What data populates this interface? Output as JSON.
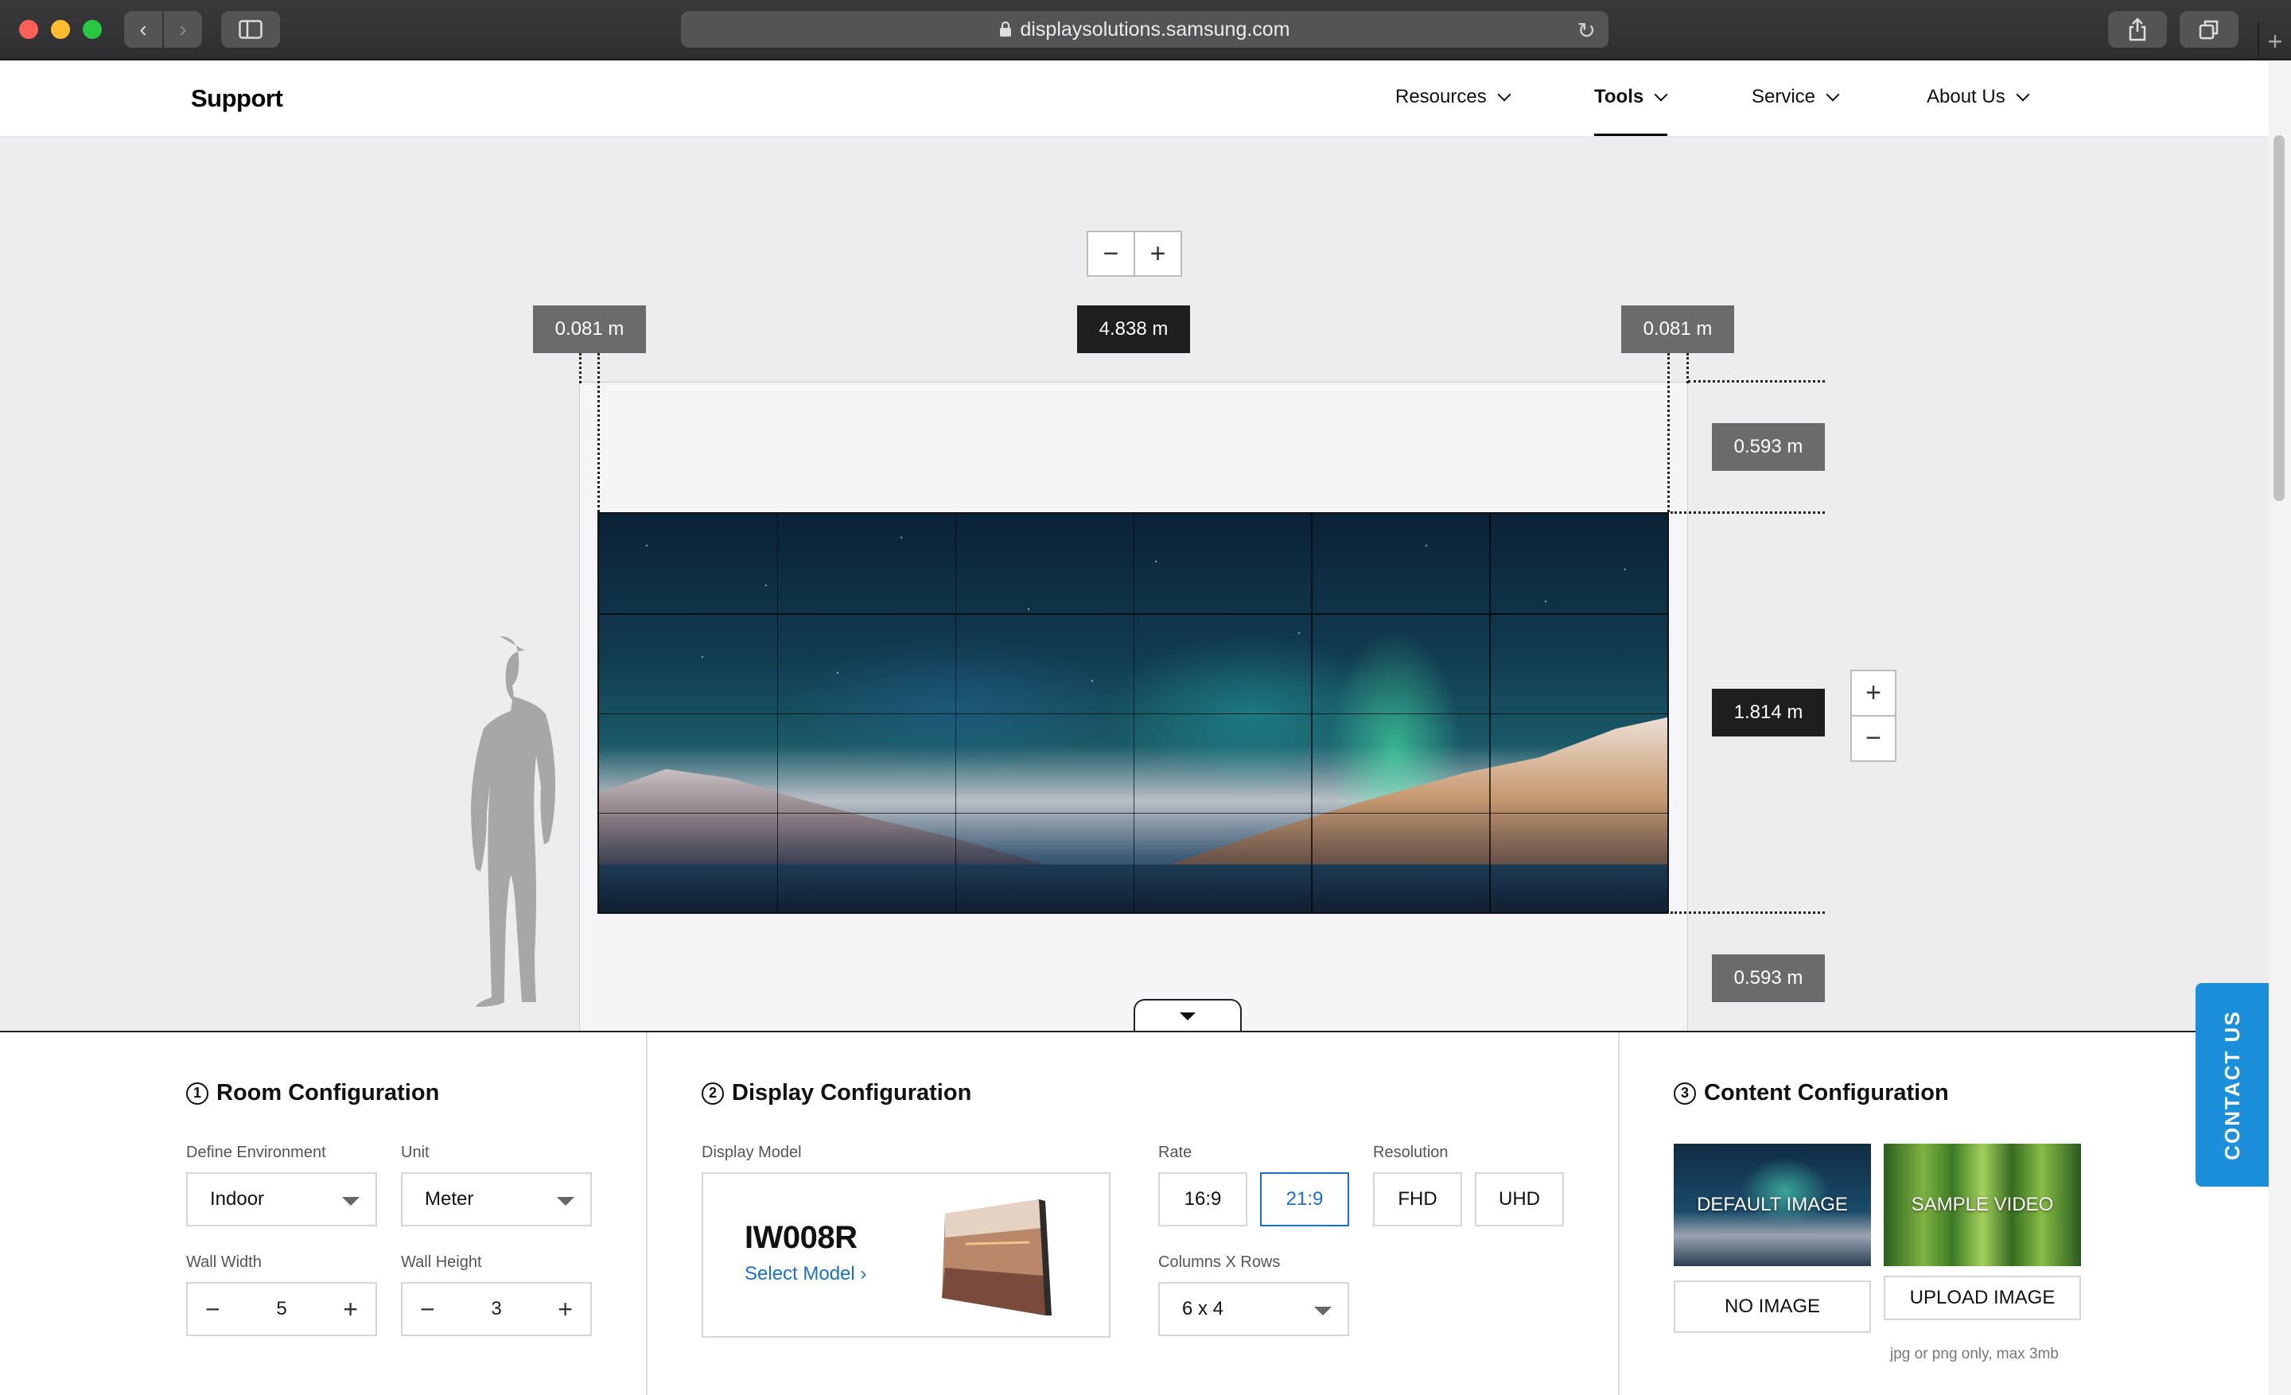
{
  "browser": {
    "url": "displaysolutions.samsung.com"
  },
  "header": {
    "brand": "Support",
    "nav": [
      {
        "label": "Resources"
      },
      {
        "label": "Tools"
      },
      {
        "label": "Service"
      },
      {
        "label": "About Us"
      }
    ],
    "active_nav": "Tools"
  },
  "canvas": {
    "zoom_out": "−",
    "zoom_in": "+",
    "measure_left": "0.081 m",
    "measure_width": "4.838 m",
    "measure_right": "0.081 m",
    "measure_top_gap": "0.593 m",
    "measure_height": "1.814 m",
    "measure_bottom_gap": "0.593 m",
    "height_plus": "+",
    "height_minus": "−"
  },
  "room": {
    "step": "1",
    "title": "Room Configuration",
    "environment_label": "Define Environment",
    "environment_value": "Indoor",
    "unit_label": "Unit",
    "unit_value": "Meter",
    "wall_width_label": "Wall Width",
    "wall_width_value": "5",
    "wall_height_label": "Wall Height",
    "wall_height_value": "3"
  },
  "display": {
    "step": "2",
    "title": "Display Configuration",
    "model_label": "Display Model",
    "model_name": "IW008R",
    "select_model": "Select Model",
    "rate_label": "Rate",
    "rate_options": [
      "16:9",
      "21:9"
    ],
    "rate_selected": "21:9",
    "resolution_label": "Resolution",
    "resolution_options": [
      "FHD",
      "UHD"
    ],
    "grid_label": "Columns X Rows",
    "grid_value": "6 x 4",
    "columns": 6,
    "rows": 4
  },
  "content": {
    "step": "3",
    "title": "Content Configuration",
    "default_image": "DEFAULT IMAGE",
    "sample_video": "SAMPLE VIDEO",
    "no_image": "NO IMAGE",
    "upload_image": "UPLOAD IMAGE",
    "hint": "jpg or png only, max 3mb"
  },
  "contact": {
    "label": "CONTACT US"
  }
}
